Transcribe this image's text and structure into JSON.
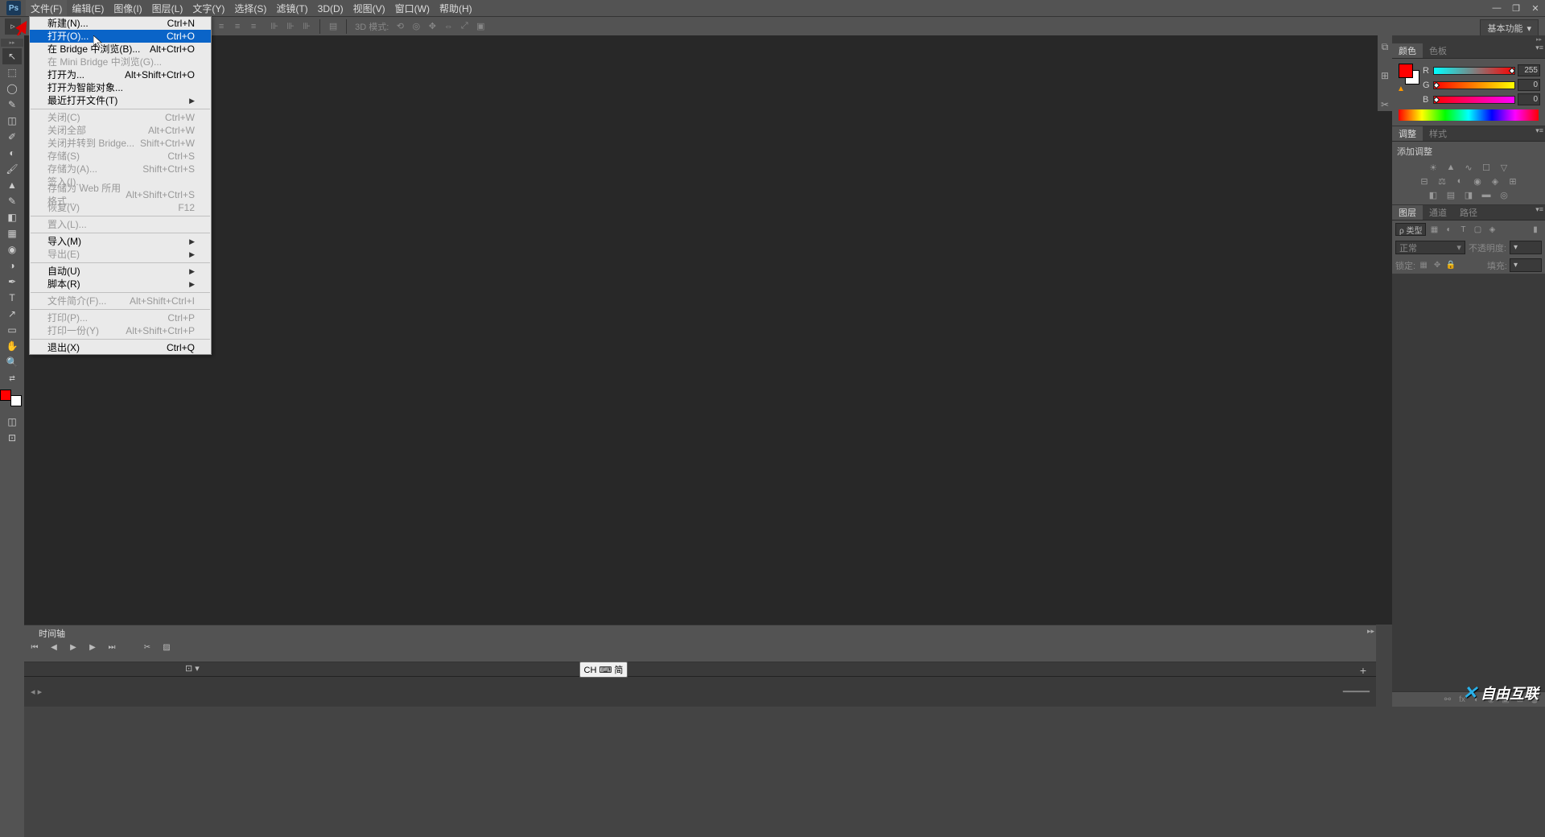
{
  "app": {
    "logo_text": "Ps"
  },
  "menubar": [
    "文件(F)",
    "编辑(E)",
    "图像(I)",
    "图层(L)",
    "文字(Y)",
    "选择(S)",
    "滤镜(T)",
    "3D(D)",
    "视图(V)",
    "窗口(W)",
    "帮助(H)"
  ],
  "file_menu": {
    "items": [
      {
        "label": "新建(N)...",
        "accel": "Ctrl+N",
        "type": "item"
      },
      {
        "label": "打开(O)...",
        "accel": "Ctrl+O",
        "type": "item",
        "hl": true
      },
      {
        "label": "在 Bridge 中浏览(B)...",
        "accel": "Alt+Ctrl+O",
        "type": "item"
      },
      {
        "label": "在 Mini Bridge 中浏览(G)...",
        "accel": "",
        "type": "item",
        "disabled": true
      },
      {
        "label": "打开为...",
        "accel": "Alt+Shift+Ctrl+O",
        "type": "item"
      },
      {
        "label": "打开为智能对象...",
        "accel": "",
        "type": "item"
      },
      {
        "label": "最近打开文件(T)",
        "accel": "",
        "type": "sub"
      },
      {
        "type": "sep"
      },
      {
        "label": "关闭(C)",
        "accel": "Ctrl+W",
        "type": "item",
        "disabled": true
      },
      {
        "label": "关闭全部",
        "accel": "Alt+Ctrl+W",
        "type": "item",
        "disabled": true
      },
      {
        "label": "关闭并转到 Bridge...",
        "accel": "Shift+Ctrl+W",
        "type": "item",
        "disabled": true
      },
      {
        "label": "存储(S)",
        "accel": "Ctrl+S",
        "type": "item",
        "disabled": true
      },
      {
        "label": "存储为(A)...",
        "accel": "Shift+Ctrl+S",
        "type": "item",
        "disabled": true
      },
      {
        "label": "签入(I)...",
        "accel": "",
        "type": "item",
        "disabled": true
      },
      {
        "label": "存储为 Web 所用格式...",
        "accel": "Alt+Shift+Ctrl+S",
        "type": "item",
        "disabled": true
      },
      {
        "label": "恢复(V)",
        "accel": "F12",
        "type": "item",
        "disabled": true
      },
      {
        "type": "sep"
      },
      {
        "label": "置入(L)...",
        "accel": "",
        "type": "item",
        "disabled": true
      },
      {
        "type": "sep"
      },
      {
        "label": "导入(M)",
        "accel": "",
        "type": "sub"
      },
      {
        "label": "导出(E)",
        "accel": "",
        "type": "sub",
        "disabled": true
      },
      {
        "type": "sep"
      },
      {
        "label": "自动(U)",
        "accel": "",
        "type": "sub"
      },
      {
        "label": "脚本(R)",
        "accel": "",
        "type": "sub"
      },
      {
        "type": "sep"
      },
      {
        "label": "文件简介(F)...",
        "accel": "Alt+Shift+Ctrl+I",
        "type": "item",
        "disabled": true
      },
      {
        "type": "sep"
      },
      {
        "label": "打印(P)...",
        "accel": "Ctrl+P",
        "type": "item",
        "disabled": true
      },
      {
        "label": "打印一份(Y)",
        "accel": "Alt+Shift+Ctrl+P",
        "type": "item",
        "disabled": true
      },
      {
        "type": "sep"
      },
      {
        "label": "退出(X)",
        "accel": "Ctrl+Q",
        "type": "item"
      }
    ]
  },
  "optionsbar": {
    "mode3d_label": "3D 模式:"
  },
  "workspace": {
    "label": "基本功能"
  },
  "timeline": {
    "tab": "时间轴",
    "track_opt": "⊡ ▾"
  },
  "panels": {
    "color": {
      "tabs": [
        "颜色",
        "色板"
      ],
      "channels": [
        "R",
        "G",
        "B"
      ],
      "values": [
        "255",
        "0",
        "0"
      ]
    },
    "adjust": {
      "tabs": [
        "调整",
        "样式"
      ],
      "add_label": "添加调整"
    },
    "layers": {
      "tabs": [
        "图层",
        "通道",
        "路径"
      ],
      "filter": "ρ 类型",
      "blend": "正常",
      "opacity_label": "不透明度:",
      "lock_label": "锁定:",
      "fill_label": "填充:"
    }
  },
  "ime": {
    "text": "CH ⌨ 简"
  },
  "watermark": {
    "text": "自由互联"
  }
}
